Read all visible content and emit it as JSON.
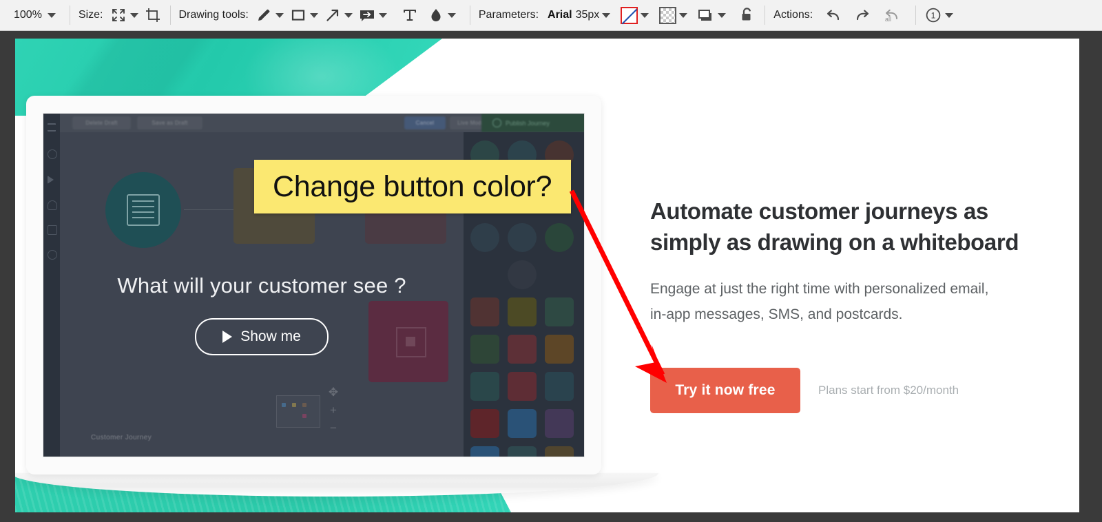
{
  "toolbar": {
    "zoom_level": "100%",
    "size_label": "Size:",
    "drawing_tools_label": "Drawing tools:",
    "parameters_label": "Parameters:",
    "actions_label": "Actions:",
    "font_name": "Arial",
    "font_size": "35px",
    "stroke_color": "#e02020",
    "tools": [
      {
        "name": "pencil-tool",
        "label": "Pencil"
      },
      {
        "name": "rectangle-tool",
        "label": "Rectangle"
      },
      {
        "name": "arrow-tool",
        "label": "Arrow"
      },
      {
        "name": "callout-tool",
        "label": "Callout"
      },
      {
        "name": "text-tool",
        "label": "Text"
      },
      {
        "name": "blur-tool",
        "label": "Blur / Fill"
      }
    ],
    "actions": [
      {
        "name": "undo-button",
        "label": "Undo"
      },
      {
        "name": "redo-button",
        "label": "Redo"
      },
      {
        "name": "undo-all-button",
        "label": "Undo all"
      }
    ],
    "step_counter": "1"
  },
  "annotation": {
    "highlight_text": "Change button color?",
    "highlight_bg": "#fbe871",
    "arrow_color": "#ff0000"
  },
  "image": {
    "marketing": {
      "headline_line1": "Automate customer journeys as",
      "headline_line2": "simply as drawing on a whiteboard",
      "subtext_line1": "Engage at just the right time with personalized email,",
      "subtext_line2": "in-app messages, SMS, and postcards.",
      "cta_label": "Try it now free",
      "cta_color": "#e8604a",
      "plans_note": "Plans start from $20/month"
    },
    "laptop_screen": {
      "topbar": {
        "chip_1": "Delete Draft",
        "chip_2": "Save as Draft",
        "chip_3": "Cancel",
        "chip_4": "Live Mode",
        "publish_label": "Publish Journey"
      },
      "headline": "What will your customer see ?",
      "button_label": "Show me",
      "footer_label": "Customer Journey",
      "zoom_controls": [
        "✥",
        "+",
        "−"
      ]
    },
    "brand_color": "#2fd3b4"
  }
}
